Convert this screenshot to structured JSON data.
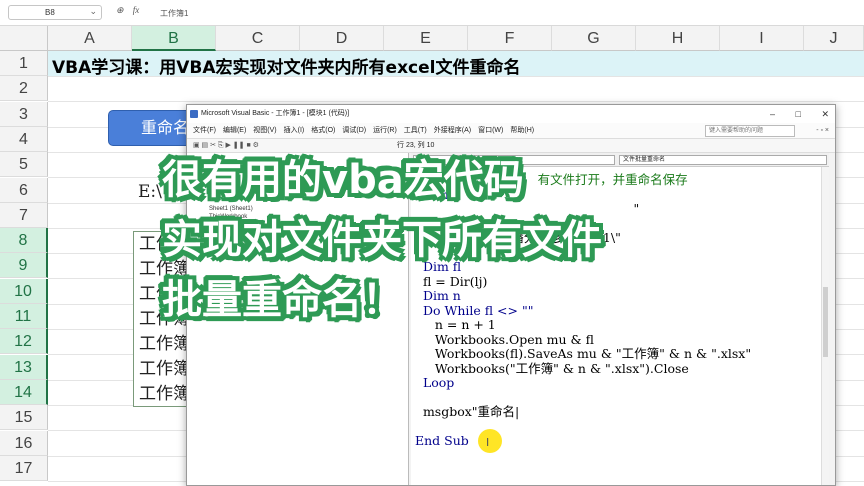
{
  "formula_bar": {
    "name_box": "B8",
    "icons": [
      "zoom-icon",
      "fx-icon"
    ],
    "fx_label": "fx",
    "value": "工作簿1"
  },
  "columns": [
    "A",
    "B",
    "C",
    "D",
    "E",
    "F",
    "G",
    "H",
    "I",
    "J"
  ],
  "selected_column": "B",
  "rows": [
    "1",
    "2",
    "3",
    "4",
    "5",
    "6",
    "7",
    "8",
    "9",
    "10",
    "11",
    "12",
    "13",
    "14",
    "15",
    "16",
    "17"
  ],
  "selected_rows": [
    "8",
    "9",
    "10",
    "11",
    "12",
    "13",
    "14"
  ],
  "sheet": {
    "title": "VBA学习课：用VBA宏实现对文件夹内所有excel文件重命名",
    "rename_button": "重命名",
    "path_cell": "E:\\",
    "file_list": [
      "工作簿",
      "工作簿",
      "工作簿",
      "工作簿",
      "工作簿",
      "工作簿",
      "工作簿"
    ]
  },
  "vba": {
    "title": "Microsoft Visual Basic - 工作簿1 - [模块1 (代码)]",
    "window_controls": [
      "–",
      "□",
      "✕"
    ],
    "menu": [
      "文件(F)",
      "编辑(E)",
      "视图(V)",
      "插入(I)",
      "格式(O)",
      "调试(D)",
      "运行(R)",
      "工具(T)",
      "外接程序(A)",
      "窗口(W)",
      "帮助(H)"
    ],
    "help_box": "键入需要帮助的问题",
    "menu_controls": "- ▫ ×",
    "cursor_pos": "行 23, 列 10",
    "project_tree": [
      "Sheet1 (Sheet1)",
      "ThisWorkbook"
    ],
    "proc_dropdown": "文件批量重命名",
    "code_lines": [
      {
        "cls": "cm",
        "text": "'                              有文件打开，并重命名保存"
      },
      {
        "cls": "kw",
        "text": "  Dim lj"
      },
      {
        "cls": "tx",
        "text": "                                                       \""
      },
      {
        "cls": "kw",
        "text": "  Dim mu"
      },
      {
        "cls": "tx",
        "text": "  mu = \"E:\\zhili播分享\\多工作簿1\\\""
      },
      {
        "cls": "tx",
        "text": ""
      },
      {
        "cls": "kw",
        "text": "  Dim fl"
      },
      {
        "cls": "tx",
        "text": "  fl = Dir(lj)"
      },
      {
        "cls": "kw",
        "text": "  Dim n"
      },
      {
        "cls": "kw",
        "text": "  Do While fl <> \"\""
      },
      {
        "cls": "tx",
        "text": "     n = n + 1"
      },
      {
        "cls": "tx",
        "text": "     Workbooks.Open mu & fl"
      },
      {
        "cls": "tx",
        "text": "     Workbooks(fl).SaveAs mu & \"工作簿\" & n & \".xlsx\""
      },
      {
        "cls": "tx",
        "text": "     Workbooks(\"工作簿\" & n & \".xlsx\").Close"
      },
      {
        "cls": "kw",
        "text": "  Loop"
      },
      {
        "cls": "tx",
        "text": ""
      },
      {
        "cls": "tx",
        "text": "  msgbox\"重命名|"
      },
      {
        "cls": "tx",
        "text": ""
      },
      {
        "cls": "kw",
        "text": "End Sub"
      }
    ]
  },
  "caption": {
    "line1": "很有用的vba宏代码",
    "line2": "实现对文件夹下所有文件",
    "line3": "批量重命名！"
  },
  "colors": {
    "accent_green": "#217346",
    "caption_outline": "#2e9a55",
    "button_blue": "#4a7fd9",
    "row1_band": "#dcf3f7"
  }
}
